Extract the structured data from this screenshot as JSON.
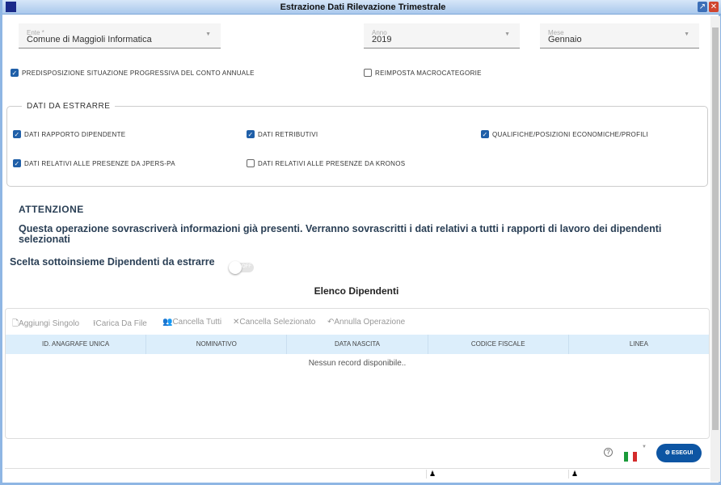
{
  "window": {
    "title": "Estrazione Dati Rilevazione Trimestrale"
  },
  "fields": {
    "ente": {
      "label": "Ente *",
      "value": "Comune di Maggioli Informatica"
    },
    "anno": {
      "label": "Anno",
      "value": "2019"
    },
    "mese": {
      "label": "Mese",
      "value": "Gennaio"
    }
  },
  "options": [
    {
      "label": "PREDISPOSIZIONE SITUAZIONE PROGRESSIVA DEL CONTO ANNUALE",
      "checked": true
    },
    {
      "label": "REIMPOSTA MACROCATEGORIE",
      "checked": false
    }
  ],
  "dati": {
    "legend": "DATI DA ESTRARRE",
    "items": [
      {
        "label": "DATI RAPPORTO DIPENDENTE",
        "checked": true
      },
      {
        "label": "DATI RETRIBUTIVI",
        "checked": true
      },
      {
        "label": "QUALIFICHE/POSIZIONI ECONOMICHE/PROFILI",
        "checked": true
      },
      {
        "label": "DATI RELATIVI ALLE PRESENZE DA JPERS-PA",
        "checked": true
      },
      {
        "label": "DATI RELATIVI ALLE PRESENZE DA KRONOS",
        "checked": false
      }
    ]
  },
  "warning": {
    "title": "ATTENZIONE",
    "text": "Questa operazione sovrascriverà informazioni già presenti. Verranno sovrascritti i dati relativi a tutti i rapporti di lavoro dei dipendenti selezionati"
  },
  "subset": {
    "label": "Scelta sottoinsieme Dipendenti da estrarre",
    "toggle": "OFF"
  },
  "grid": {
    "title": "Elenco Dipendenti",
    "toolbar": [
      "Aggiungi Singolo",
      "Carica Da File",
      "Cancella Tutti",
      "Cancella Selezionato",
      "Annulla Operazione"
    ],
    "columns": [
      "ID. ANAGRAFE UNICA",
      "NOMINATIVO",
      "DATA NASCITA",
      "CODICE FISCALE",
      "LINEA"
    ],
    "empty": "Nessun record disponibile.."
  },
  "footer": {
    "help": "?",
    "run": "ESEGUI"
  },
  "colors": {
    "accent": "#1f5fa8",
    "button": "#0d55a3",
    "header": "#dceefb"
  }
}
